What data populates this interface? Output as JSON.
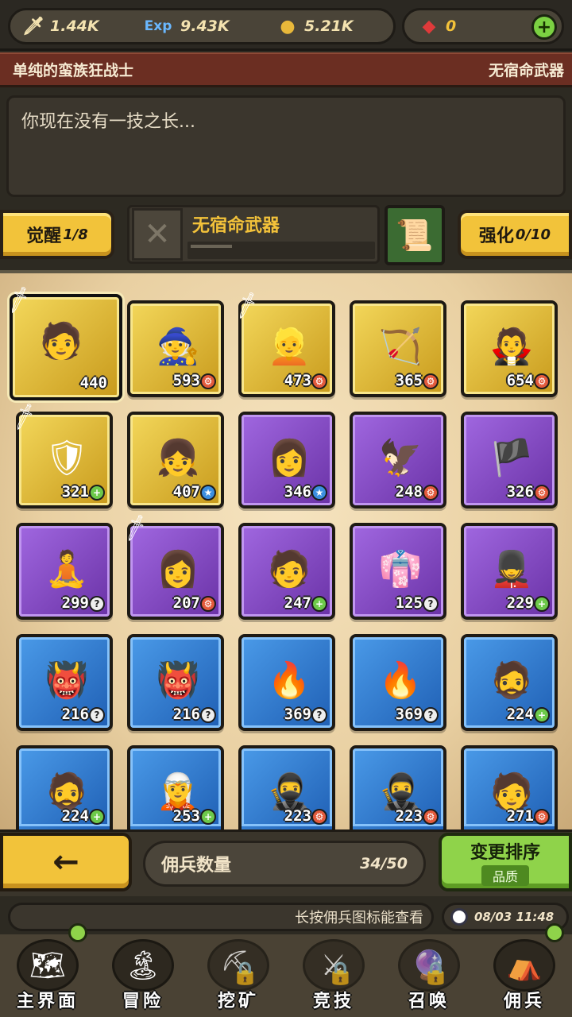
{
  "resources": {
    "attack": {
      "icon": "sword-icon",
      "value": "1.44K"
    },
    "exp": {
      "icon": "exp-icon",
      "label": "Exp",
      "value": "9.43K"
    },
    "gold": {
      "icon": "coin-icon",
      "value": "5.21K"
    },
    "gem": {
      "icon": "gem-icon",
      "value": "0"
    }
  },
  "hero": {
    "name": "单纯的蛮族狂战士",
    "weapon_status": "无宿命武器",
    "description": "你现在没有一技之长...",
    "awaken_label": "觉醒",
    "awaken_value": "1/8",
    "enhance_label": "强化",
    "enhance_value": "0/10",
    "fate_weapon": "无宿命武器"
  },
  "cards": [
    {
      "rarity": "gold",
      "level": "440",
      "badge": "none",
      "selected": true,
      "hero_icon": "blonde-warrior",
      "weapon": true
    },
    {
      "rarity": "gold",
      "level": "593",
      "badge": "gear",
      "hero_icon": "old-sage"
    },
    {
      "rarity": "gold",
      "level": "473",
      "badge": "gear",
      "hero_icon": "blonde-knight",
      "weapon": true
    },
    {
      "rarity": "gold",
      "level": "365",
      "badge": "gear",
      "hero_icon": "green-archer"
    },
    {
      "rarity": "gold",
      "level": "654",
      "badge": "gear",
      "hero_icon": "dark-mage"
    },
    {
      "rarity": "gold",
      "level": "321",
      "badge": "plus",
      "hero_icon": "armored-knight",
      "weapon": true
    },
    {
      "rarity": "gold",
      "level": "407",
      "badge": "star",
      "hero_icon": "dark-haired-girl"
    },
    {
      "rarity": "purple",
      "level": "346",
      "badge": "star",
      "hero_icon": "blonde-girl"
    },
    {
      "rarity": "purple",
      "level": "248",
      "badge": "gear",
      "hero_icon": "winged-warrior"
    },
    {
      "rarity": "purple",
      "level": "326",
      "badge": "gear",
      "hero_icon": "pirate"
    },
    {
      "rarity": "purple",
      "level": "299",
      "badge": "q",
      "hero_icon": "bald-monk"
    },
    {
      "rarity": "purple",
      "level": "207",
      "badge": "gear",
      "hero_icon": "brown-haired-girl",
      "weapon": true
    },
    {
      "rarity": "purple",
      "level": "247",
      "badge": "plus",
      "hero_icon": "young-man"
    },
    {
      "rarity": "purple",
      "level": "125",
      "badge": "q",
      "hero_icon": "shrine-maiden"
    },
    {
      "rarity": "purple",
      "level": "229",
      "badge": "plus",
      "hero_icon": "soldier"
    },
    {
      "rarity": "blue",
      "level": "216",
      "badge": "q",
      "hero_icon": "red-demon"
    },
    {
      "rarity": "blue",
      "level": "216",
      "badge": "q",
      "hero_icon": "red-demon"
    },
    {
      "rarity": "blue",
      "level": "369",
      "badge": "q",
      "hero_icon": "fire-hair-girl"
    },
    {
      "rarity": "blue",
      "level": "369",
      "badge": "q",
      "hero_icon": "fire-hair-girl"
    },
    {
      "rarity": "blue",
      "level": "224",
      "badge": "plus",
      "hero_icon": "bearded-elder"
    },
    {
      "rarity": "blue",
      "level": "224",
      "badge": "plus",
      "hero_icon": "bearded-elder"
    },
    {
      "rarity": "blue",
      "level": "253",
      "badge": "plus",
      "hero_icon": "hooded-figure"
    },
    {
      "rarity": "blue",
      "level": "223",
      "badge": "gear",
      "hero_icon": "red-scarf-ninja"
    },
    {
      "rarity": "blue",
      "level": "223",
      "badge": "gear",
      "hero_icon": "red-scarf-ninja"
    },
    {
      "rarity": "blue",
      "level": "271",
      "badge": "gear",
      "hero_icon": "silver-hair-fighter"
    }
  ],
  "footer": {
    "back_label": "←",
    "count_label": "佣兵数量",
    "count_value": "34/50",
    "sort_label": "变更排序",
    "sort_sub": "品质",
    "ticker": "长按佣兵图标能查看",
    "time": "08/03 11:48"
  },
  "nav": [
    {
      "label": "主界面",
      "icon": "map-icon",
      "dot": true
    },
    {
      "label": "冒险",
      "icon": "island-icon"
    },
    {
      "label": "挖矿",
      "icon": "pickaxe-icon",
      "locked": true
    },
    {
      "label": "竞技",
      "icon": "crossed-swords-icon",
      "locked": true
    },
    {
      "label": "召唤",
      "icon": "summon-icon",
      "locked": true
    },
    {
      "label": "佣兵",
      "icon": "tent-icon",
      "dot": true
    }
  ]
}
